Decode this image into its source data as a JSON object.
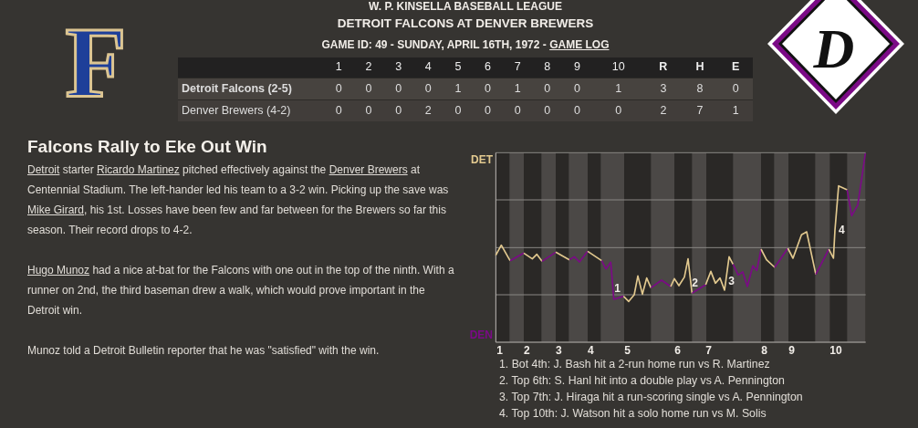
{
  "league": "W. P. KINSELLA BASEBALL LEAGUE",
  "matchup": "DETROIT FALCONS AT DENVER BREWERS",
  "game_info": {
    "text": "GAME ID: 49 - SUNDAY, APRIL 16TH, 1972 - ",
    "link": "GAME LOG"
  },
  "away_logo": {
    "letter": "F"
  },
  "home_logo": {
    "letter": "D"
  },
  "linescore": {
    "columns": [
      {
        "label": "1",
        "kind": "inning"
      },
      {
        "label": "2",
        "kind": "inning"
      },
      {
        "label": "3",
        "kind": "inning"
      },
      {
        "label": "4",
        "kind": "inning"
      },
      {
        "label": "5",
        "kind": "inning"
      },
      {
        "label": "6",
        "kind": "inning"
      },
      {
        "label": "7",
        "kind": "inning"
      },
      {
        "label": "8",
        "kind": "inning"
      },
      {
        "label": "9",
        "kind": "inning"
      },
      {
        "label": "10",
        "kind": "inning"
      },
      {
        "label": "R",
        "kind": "total"
      },
      {
        "label": "H",
        "kind": "total"
      },
      {
        "label": "E",
        "kind": "total"
      }
    ],
    "rows": [
      {
        "team": "Detroit Falcons (2-5)",
        "winner": true,
        "cells": [
          "0",
          "0",
          "0",
          "0",
          "1",
          "0",
          "1",
          "0",
          "0",
          "1",
          "3",
          "8",
          "0"
        ]
      },
      {
        "team": "Denver Brewers (4-2)",
        "winner": false,
        "cells": [
          "0",
          "0",
          "0",
          "2",
          "0",
          "0",
          "0",
          "0",
          "0",
          "0",
          "2",
          "7",
          "1"
        ]
      }
    ]
  },
  "article": {
    "title": "Falcons Rally to Eke Out Win",
    "paragraphs": [
      [
        {
          "text": "Detroit",
          "link": true
        },
        {
          "text": " starter ",
          "link": false
        },
        {
          "text": "Ricardo Martinez",
          "link": true
        },
        {
          "text": " pitched effectively against the ",
          "link": false
        },
        {
          "text": "Denver Brewers",
          "link": true
        },
        {
          "text": " at Centennial Stadium. The left-hander led his team to a 3-2 win. Picking up the save was ",
          "link": false
        },
        {
          "text": "Mike Girard",
          "link": true
        },
        {
          "text": ", his 1st. Losses have been few and far between for the Brewers so far this season. Their record drops to 4-2.",
          "link": false
        }
      ],
      [
        {
          "text": "Hugo Munoz",
          "link": true
        },
        {
          "text": " had a nice at-bat for the Falcons with one out in the top of the ninth. With a runner on 2nd, the third baseman drew a walk, which would prove important in the Detroit win.",
          "link": false
        }
      ],
      [
        {
          "text": "Munoz told a Detroit Bulletin reporter that he was \"satisfied\" with the win.",
          "link": false
        }
      ]
    ]
  },
  "win_chart": {
    "top_label": "DET",
    "bottom_label": "DEN",
    "innings": [
      "1",
      "2",
      "3",
      "4",
      "5",
      "6",
      "7",
      "8",
      "9",
      "10"
    ],
    "markers": [
      "1",
      "2",
      "3",
      "4"
    ]
  },
  "events": [
    "1. Bot 4th: J. Bash hit a 2-run home run vs R. Martinez",
    "2. Top 6th: S. Hanl hit into a double play vs A. Pennington",
    "3. Top 7th: J. Hiraga hit a run-scoring single vs A. Pennington",
    "4. Top 10th: J. Watson hit a solo home run vs M. Solis"
  ]
}
